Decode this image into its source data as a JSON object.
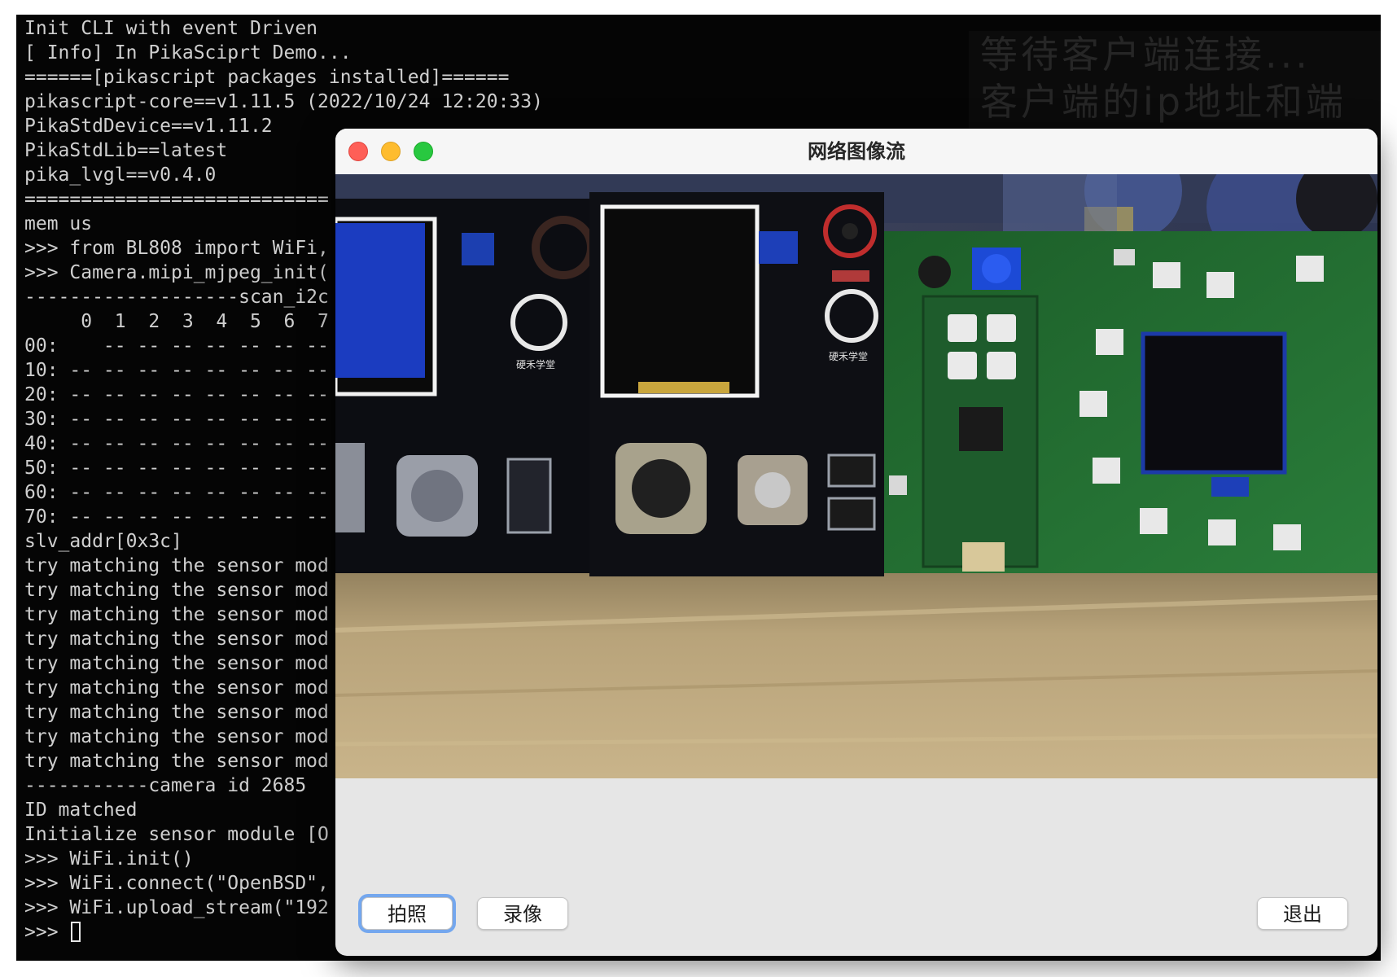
{
  "terminal": {
    "lines": [
      "Init CLI with event Driven",
      "[ Info] In PikaSciprt Demo...",
      "======[pikascript packages installed]======",
      "pikascript-core==v1.11.5 (2022/10/24 12:20:33)",
      "PikaStdDevice==v1.11.2",
      "PikaStdLib==latest",
      "pika_lvgl==v0.4.0",
      "===========================",
      "mem us",
      ">>> from BL808 import WiFi,",
      ">>> Camera.mipi_mjpeg_init(",
      "-------------------scan_i2c",
      "     0  1  2  3  4  5  6  7",
      "00:    -- -- -- -- -- -- --",
      "10: -- -- -- -- -- -- -- --",
      "20: -- -- -- -- -- -- -- --",
      "30: -- -- -- -- -- -- -- --",
      "40: -- -- -- -- -- -- -- --",
      "50: -- -- -- -- -- -- -- --",
      "60: -- -- -- -- -- -- -- --",
      "70: -- -- -- -- -- -- -- --",
      "slv_addr[0x3c]",
      "try matching the sensor mod",
      "try matching the sensor mod",
      "try matching the sensor mod",
      "try matching the sensor mod",
      "try matching the sensor mod",
      "try matching the sensor mod",
      "try matching the sensor mod",
      "try matching the sensor mod",
      "try matching the sensor mod",
      "-----------camera id 2685",
      "ID matched",
      "Initialize sensor module [O",
      ">>> WiFi.init()",
      ">>> WiFi.connect(\"OpenBSD\",",
      ">>> WiFi.upload_stream(\"192"
    ],
    "prompt": ">>> "
  },
  "server_window": {
    "lines": [
      "等待客户端连接...",
      "客户端的ip地址和端"
    ]
  },
  "stream_window": {
    "title": "网络图像流",
    "buttons": {
      "photo": "拍照",
      "record": "录像",
      "exit": "退出"
    }
  },
  "colors": {
    "terminal_bg": "#050505",
    "terminal_text": "#cfcfcf",
    "window_bg": "#e6e6e6",
    "focus_ring": "#74a7ee",
    "close": "#fe5f57",
    "minimize": "#febc2e",
    "maximize": "#28c840",
    "pcb_green": "#1f6a2e",
    "board_black": "#0e0f14",
    "table_wood": "#b39b70"
  },
  "camera_frame": {
    "scene": "camera-stream-dev-boards"
  }
}
